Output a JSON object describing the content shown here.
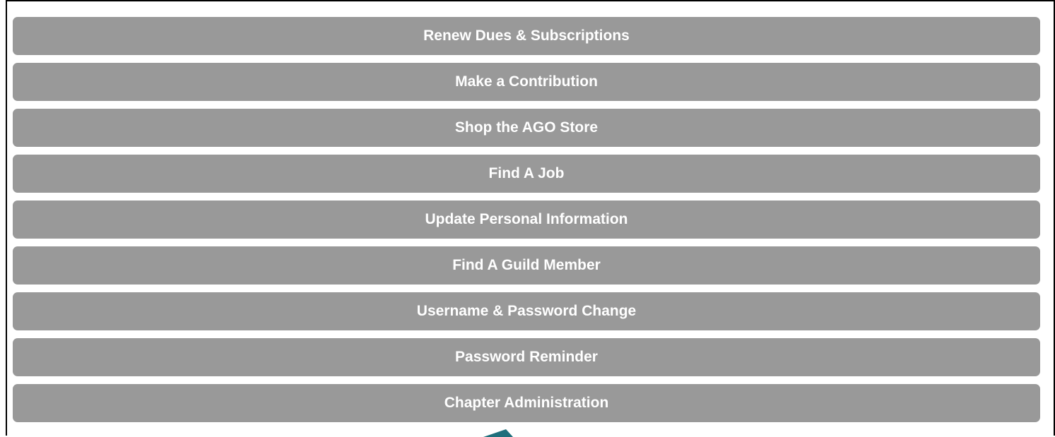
{
  "menu": {
    "items": [
      {
        "label": "Renew Dues & Subscriptions"
      },
      {
        "label": "Make a Contribution"
      },
      {
        "label": "Shop the AGO Store"
      },
      {
        "label": "Find A Job"
      },
      {
        "label": "Update Personal Information"
      },
      {
        "label": "Find A Guild Member"
      },
      {
        "label": "Username & Password Change"
      },
      {
        "label": "Password Reminder"
      },
      {
        "label": "Chapter Administration"
      }
    ]
  },
  "colors": {
    "button_bg": "#999999",
    "button_text": "#ffffff",
    "frame_border": "#000000",
    "pointer": "#1f6f7c"
  },
  "icons": {
    "pointer": "pointer-arrow-icon"
  }
}
